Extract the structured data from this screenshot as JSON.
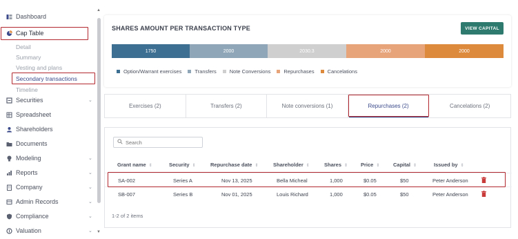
{
  "sidebar": {
    "items": [
      {
        "label": "Dashboard",
        "icon": "dashboard-icon"
      },
      {
        "label": "Cap Table",
        "icon": "pie-chart-icon"
      },
      {
        "label": "Securities",
        "icon": "securities-icon",
        "chevron": "⌄"
      },
      {
        "label": "Spreadsheet",
        "icon": "spreadsheet-icon"
      },
      {
        "label": "Shareholders",
        "icon": "user-icon"
      },
      {
        "label": "Documents",
        "icon": "folder-icon"
      },
      {
        "label": "Modeling",
        "icon": "bulb-icon",
        "chevron": "⌄"
      },
      {
        "label": "Reports",
        "icon": "reports-icon",
        "chevron": "⌄"
      },
      {
        "label": "Company",
        "icon": "company-icon",
        "chevron": "⌄"
      },
      {
        "label": "Admin Records",
        "icon": "records-icon",
        "chevron": "⌄"
      },
      {
        "label": "Compliance",
        "icon": "shield-icon",
        "chevron": "⌄"
      },
      {
        "label": "Valuation",
        "icon": "valuation-icon",
        "chevron": "⌄"
      }
    ],
    "cap_table_sub": [
      "Detail",
      "Summary",
      "Vesting and plans",
      "Secondary transactions",
      "Timeline"
    ],
    "accent": "#3b4a8a",
    "highlight": "#b2272d"
  },
  "summary": {
    "title": "SHARES AMOUNT PER TRANSACTION TYPE",
    "view_capital": "VIEW CAPITAL",
    "segments": [
      {
        "value": "1750",
        "color": "#3d6f92"
      },
      {
        "value": "2000",
        "color": "#8ea6b7"
      },
      {
        "value": "2030.3",
        "color": "#cfcfcf"
      },
      {
        "value": "2000",
        "color": "#e7a37a"
      },
      {
        "value": "2000",
        "color": "#dd8a3d"
      }
    ],
    "legend": [
      {
        "label": "Option/Warrant exercises",
        "color": "#3d6f92"
      },
      {
        "label": "Transfers",
        "color": "#8ea6b7"
      },
      {
        "label": "Note Conversions",
        "color": "#cfcfcf"
      },
      {
        "label": "Repurchases",
        "color": "#e7a37a"
      },
      {
        "label": "Cancelations",
        "color": "#dd8a3d"
      }
    ]
  },
  "tabs": [
    {
      "label": "Exercises (2)"
    },
    {
      "label": "Transfers (2)"
    },
    {
      "label": "Note conversions (1)"
    },
    {
      "label": "Repurchases (2)"
    },
    {
      "label": "Cancelations (2)"
    }
  ],
  "table": {
    "search_placeholder": "Search",
    "columns": [
      "Grant name",
      "Security",
      "Repurchase date",
      "Shareholder",
      "Shares",
      "Price",
      "Capital",
      "Issued by"
    ],
    "rows": [
      [
        "SA-002",
        "Series A",
        "Nov 13, 2025",
        "Bella Micheal",
        "1,000",
        "$0.05",
        "$50",
        "Peter Anderson"
      ],
      [
        "SB-007",
        "Series B",
        "Nov 01, 2025",
        "Louis Richard",
        "1,000",
        "$0.05",
        "$50",
        "Peter Anderson"
      ]
    ],
    "footer": "1-2 of 2 items"
  }
}
